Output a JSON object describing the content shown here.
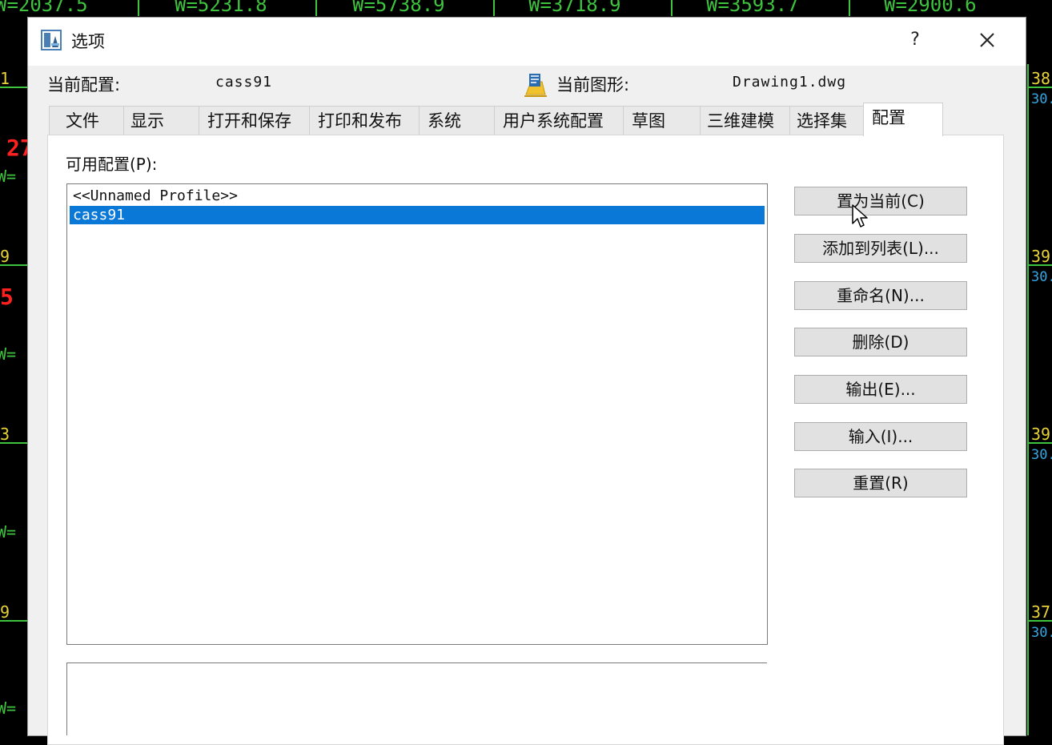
{
  "background": {
    "top_readouts": [
      "W=2037.5",
      "W=5231.8",
      "W=5738.9",
      "W=3718.9",
      "W=3593.7",
      "W=2900.6"
    ],
    "left_labels": [
      "1",
      "27",
      "W=",
      "9",
      "5",
      "W=",
      "3",
      "W=",
      "9",
      "W="
    ],
    "right_labels": [
      "38.",
      "30.",
      "39.",
      "30.",
      "39.",
      "30.",
      "37.",
      "30."
    ]
  },
  "dialog": {
    "title": "选项",
    "help_label": "?",
    "current_profile_label": "当前配置:",
    "current_profile_value": "cass91",
    "current_drawing_label": "当前图形:",
    "current_drawing_value": "Drawing1.dwg",
    "tabs": [
      "文件",
      "显示",
      "打开和保存",
      "打印和发布",
      "系统",
      "用户系统配置",
      "草图",
      "三维建模",
      "选择集",
      "配置"
    ],
    "active_tab": "配置",
    "available_profiles_label": "可用配置(P):",
    "profiles": [
      "<<Unnamed Profile>>",
      "cass91"
    ],
    "selected_profile": "cass91",
    "buttons": {
      "set_current": "置为当前(C)",
      "add_to_list": "添加到列表(L)...",
      "rename": "重命名(N)...",
      "delete": "删除(D)",
      "export": "输出(E)...",
      "import": "输入(I)...",
      "reset": "重置(R)"
    }
  },
  "colors": {
    "selection": "#0a78d7",
    "cad_green": "#3ec33e",
    "cad_yellow": "#e8d23a",
    "cad_cyan": "#33a9e6",
    "cad_red": "#ff2020"
  }
}
